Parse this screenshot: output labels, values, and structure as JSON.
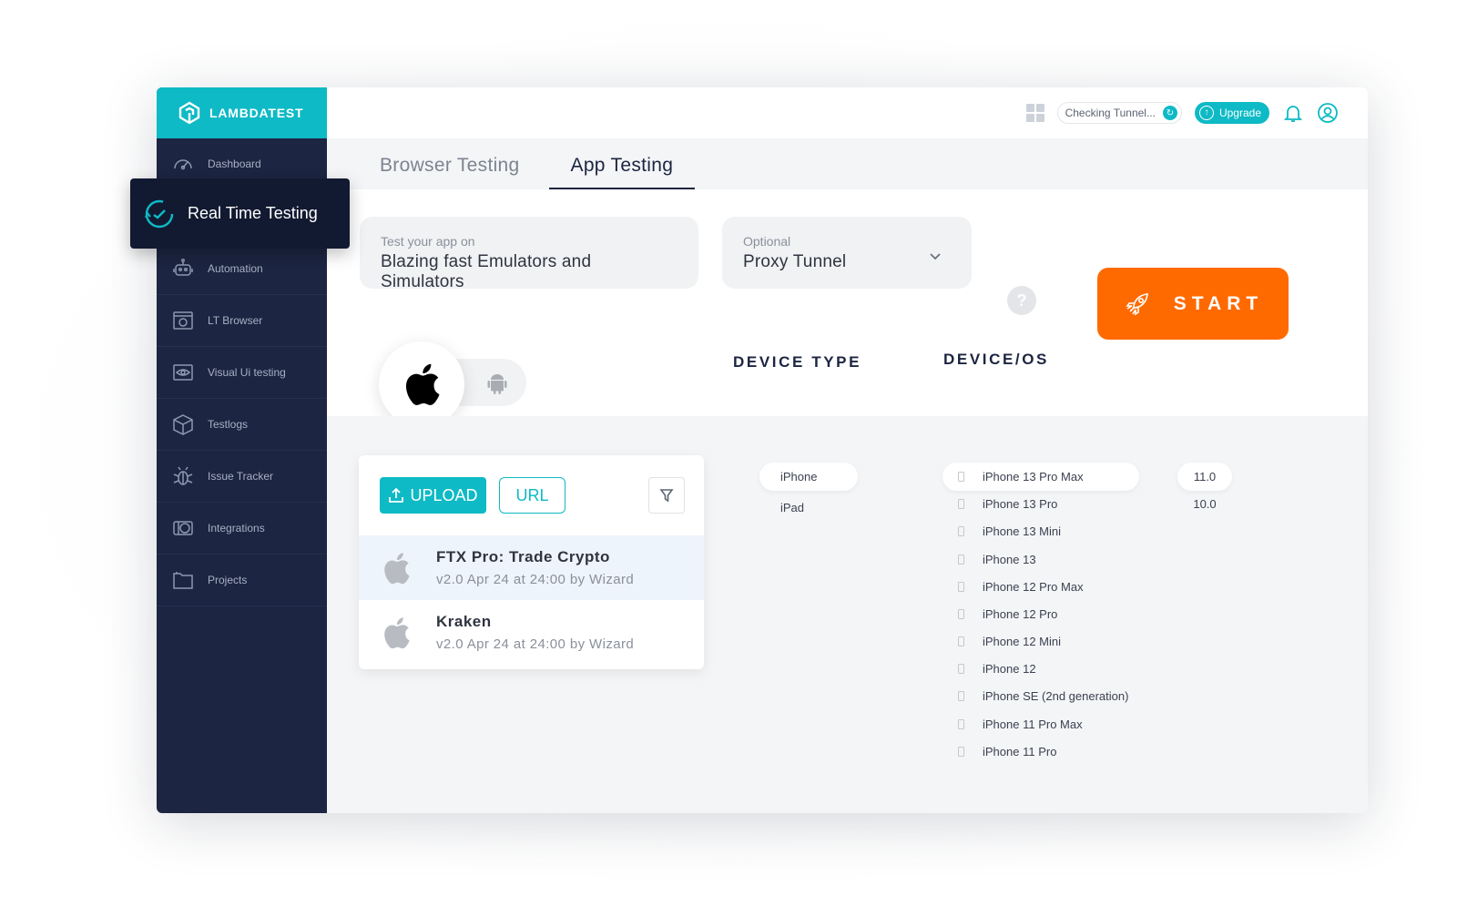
{
  "brand": {
    "name": "LAMBDATEST"
  },
  "sidebar": {
    "items": [
      {
        "label": "Dashboard",
        "icon": "dashboard-icon"
      },
      {
        "label": "Automation",
        "icon": "robot-icon"
      },
      {
        "label": "LT Browser",
        "icon": "browser-icon"
      },
      {
        "label": "Visual Ui testing",
        "icon": "eye-icon"
      },
      {
        "label": "Testlogs",
        "icon": "box-icon"
      },
      {
        "label": "Issue Tracker",
        "icon": "bug-icon"
      },
      {
        "label": "Integrations",
        "icon": "integrations-icon"
      },
      {
        "label": "Projects",
        "icon": "folder-icon"
      }
    ],
    "popout": {
      "label": "Real Time Testing",
      "icon": "realtime-icon"
    }
  },
  "topbar": {
    "tunnel_status": "Checking Tunnel...",
    "upgrade_label": "Upgrade"
  },
  "tabs": [
    {
      "label": "Browser Testing",
      "active": false
    },
    {
      "label": "App Testing",
      "active": true
    }
  ],
  "test_target": {
    "hint": "Test your app on",
    "value": "Blazing fast Emulators and Simulators"
  },
  "tunnel_select": {
    "hint": "Optional",
    "value": "Proxy Tunnel"
  },
  "help_label": "?",
  "start_label": "START",
  "os_options": [
    {
      "name": "apple-icon",
      "selected": true
    },
    {
      "name": "android-icon",
      "selected": false
    }
  ],
  "columns": {
    "device_type": "DEVICE TYPE",
    "device_os": "DEVICE/OS"
  },
  "upload": {
    "upload_label": "UPLOAD",
    "url_label": "URL"
  },
  "apps": [
    {
      "name": "FTX Pro: Trade Crypto",
      "meta": "v2.0 Apr 24 at 24:00 by Wizard",
      "selected": true
    },
    {
      "name": "Kraken",
      "meta": "v2.0 Apr 24 at 24:00 by Wizard",
      "selected": false
    }
  ],
  "device_types": [
    {
      "label": "iPhone",
      "selected": true
    },
    {
      "label": "iPad",
      "selected": false
    }
  ],
  "devices": [
    {
      "label": "iPhone 13 Pro Max",
      "selected": true
    },
    {
      "label": "iPhone 13 Pro",
      "selected": false
    },
    {
      "label": "iPhone 13 Mini",
      "selected": false
    },
    {
      "label": "iPhone 13",
      "selected": false
    },
    {
      "label": "iPhone 12 Pro Max",
      "selected": false
    },
    {
      "label": "iPhone 12 Pro",
      "selected": false
    },
    {
      "label": "iPhone 12 Mini",
      "selected": false
    },
    {
      "label": "iPhone 12",
      "selected": false
    },
    {
      "label": "iPhone SE (2nd generation)",
      "selected": false
    },
    {
      "label": "iPhone 11 Pro Max",
      "selected": false
    },
    {
      "label": "iPhone 11 Pro",
      "selected": false
    }
  ],
  "os_versions": [
    {
      "label": "11.0",
      "selected": true
    },
    {
      "label": "10.0",
      "selected": false
    }
  ],
  "colors": {
    "accent": "#0ebac5",
    "sidebar": "#1c2541",
    "start": "#ff6a00"
  }
}
